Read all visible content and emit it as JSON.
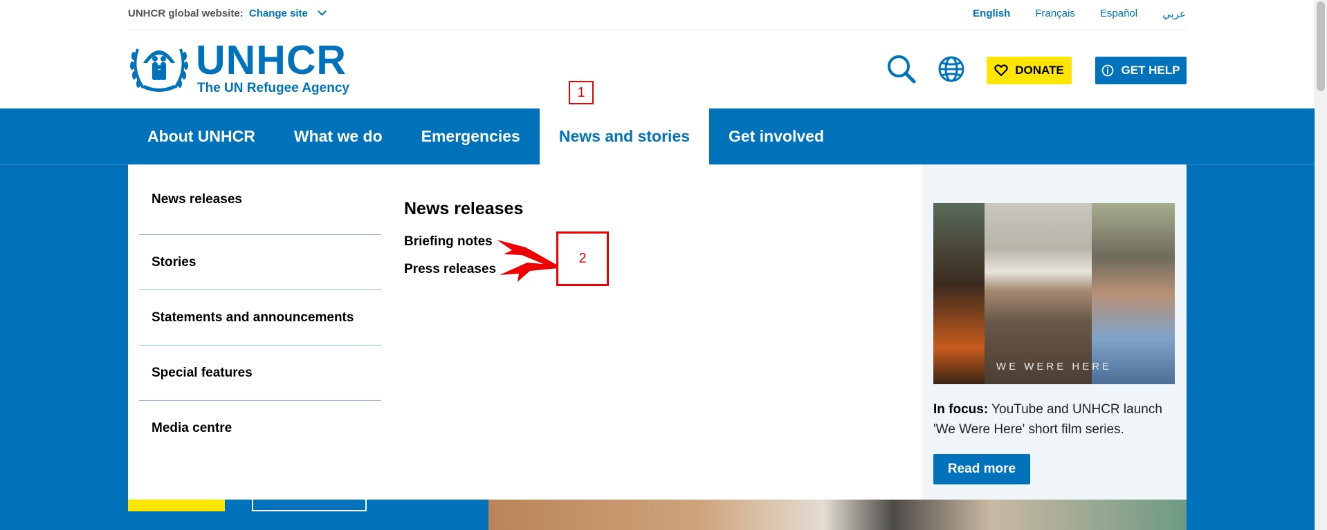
{
  "utility": {
    "site_label": "UNHCR global website:",
    "change_site": "Change site",
    "languages": [
      "English",
      "Français",
      "Español",
      "عربي"
    ]
  },
  "logo": {
    "wordmark": "UNHCR",
    "tagline": "The UN Refugee Agency"
  },
  "header": {
    "donate": "DONATE",
    "get_help": "GET HELP"
  },
  "nav": {
    "items": [
      "About UNHCR",
      "What we do",
      "Emergencies",
      "News and stories",
      "Get involved"
    ],
    "active": "News and stories"
  },
  "menu": {
    "left_items": [
      "News releases",
      "Stories",
      "Statements and announcements",
      "Special features",
      "Media centre"
    ],
    "section_heading": "News releases",
    "sub_links": [
      "Briefing notes",
      "Press releases"
    ],
    "feature": {
      "image_caption": "WE WERE HERE",
      "label": "In focus:",
      "text": " YouTube and UNHCR launch 'We Were Here' short film series.",
      "cta": "Read more"
    }
  },
  "annotations": {
    "box1": "1",
    "box2": "2"
  },
  "colors": {
    "brand_blue": "#0072bc",
    "donate_yellow": "#ffe600",
    "annotation_red": "#ee0000"
  }
}
